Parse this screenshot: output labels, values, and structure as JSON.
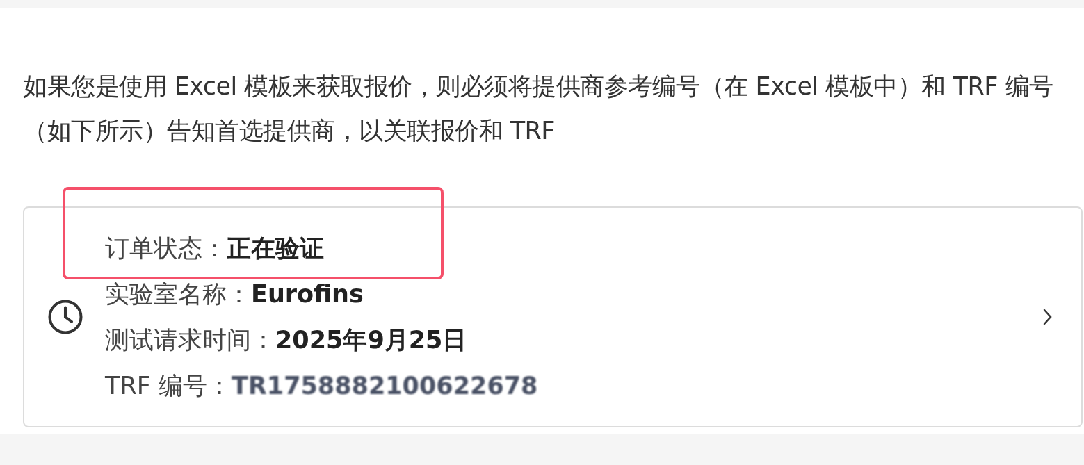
{
  "notice": "如果您是使用 Excel 模板来获取报价，则必须将提供商参考编号（在 Excel 模板中）和 TRF 编号（如下所示）告知首选提供商，以关联报价和 TRF",
  "order_card": {
    "fields": [
      {
        "label": "订单状态：",
        "value": "正在验证",
        "highlighted": true,
        "blurred": false
      },
      {
        "label": "实验室名称：",
        "value": "Eurofins",
        "highlighted": false,
        "blurred": false
      },
      {
        "label": "测试请求时间：",
        "value": "2025年9月25日",
        "highlighted": false,
        "blurred": false
      },
      {
        "label": "TRF 编号：",
        "value": "TR1758882100622678",
        "highlighted": false,
        "blurred": true
      }
    ]
  }
}
